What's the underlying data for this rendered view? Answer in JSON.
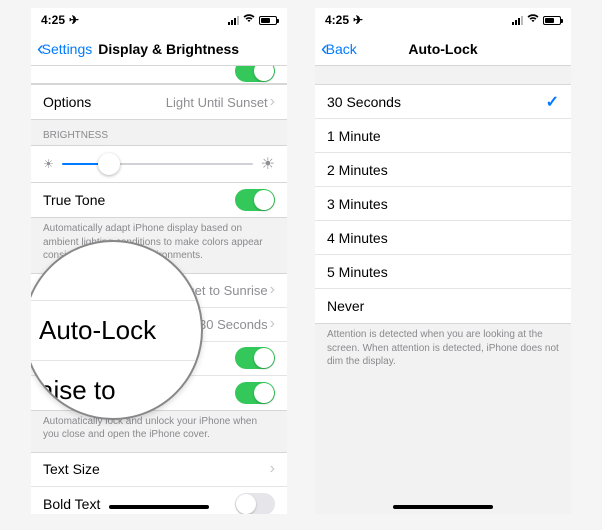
{
  "status": {
    "time": "4:25",
    "location_glyph": "◂"
  },
  "left": {
    "back_label": "Settings",
    "title": "Display & Brightness",
    "options_label": "Options",
    "options_value": "Light Until Sunset",
    "brightness_header": "BRIGHTNESS",
    "true_tone_label": "True Tone",
    "true_tone_note": "Automatically adapt iPhone display based on ambient lighting conditions to make colors appear consistent in different environments.",
    "night_shift_value": "Sunset to Sunrise",
    "auto_lock_label": "Auto-Lock",
    "auto_lock_value": "30 Seconds",
    "raise_label": "aise to",
    "lock_note": "Automatically lock and unlock your iPhone when you close and open the iPhone cover.",
    "text_size_label": "Text Size",
    "bold_text_label": "Bold Text",
    "magnifier_main": "Auto-Lock"
  },
  "right": {
    "back_label": "Back",
    "title": "Auto-Lock",
    "options": [
      {
        "label": "30 Seconds",
        "selected": true
      },
      {
        "label": "1 Minute",
        "selected": false
      },
      {
        "label": "2 Minutes",
        "selected": false
      },
      {
        "label": "3 Minutes",
        "selected": false
      },
      {
        "label": "4 Minutes",
        "selected": false
      },
      {
        "label": "5 Minutes",
        "selected": false
      },
      {
        "label": "Never",
        "selected": false
      }
    ],
    "footer": "Attention is detected when you are looking at the screen. When attention is detected, iPhone does not dim the display."
  }
}
